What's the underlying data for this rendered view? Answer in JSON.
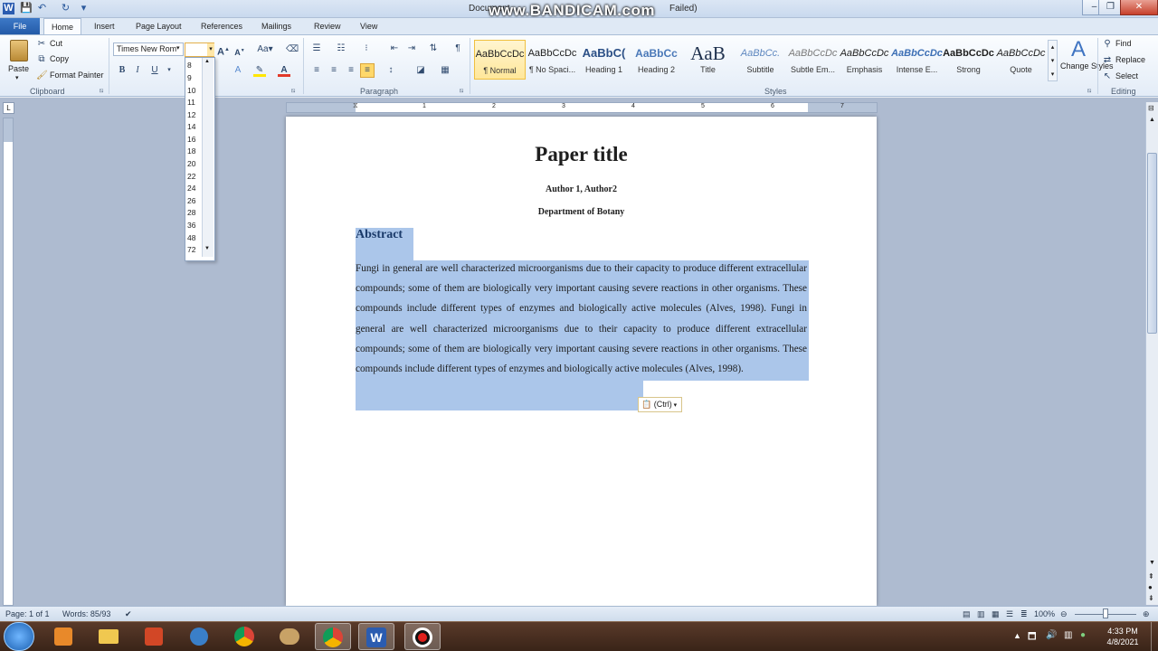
{
  "window": {
    "title": "Document",
    "title_tail": "Failed)",
    "watermark": "www.BANDICAM.com",
    "controls": [
      "–",
      "❐",
      "✕"
    ]
  },
  "tabs": {
    "file": "File",
    "items": [
      "Home",
      "Insert",
      "Page Layout",
      "References",
      "Mailings",
      "Review",
      "View"
    ]
  },
  "clipboard": {
    "paste": "Paste",
    "cut": "Cut",
    "copy": "Copy",
    "format_painter": "Format Painter",
    "label": "Clipboard"
  },
  "font": {
    "family": "Times New Rom",
    "size": "",
    "bold": "B",
    "italic": "I",
    "underline": "U",
    "change_case": "Aa",
    "sizes": [
      "8",
      "9",
      "10",
      "11",
      "12",
      "14",
      "16",
      "18",
      "20",
      "22",
      "24",
      "26",
      "28",
      "36",
      "48",
      "72"
    ]
  },
  "paragraph": {
    "label": "Paragraph",
    "pilcrow": "¶"
  },
  "styles": {
    "label": "Styles",
    "items": [
      {
        "sample": "AaBbCcDc",
        "name": "¶ Normal"
      },
      {
        "sample": "AaBbCcDc",
        "name": "¶ No Spaci..."
      },
      {
        "sample": "AaBbC(",
        "name": "Heading 1"
      },
      {
        "sample": "AaBbCc",
        "name": "Heading 2"
      },
      {
        "sample": "AaB",
        "name": "Title"
      },
      {
        "sample": "AaBbCc.",
        "name": "Subtitle"
      },
      {
        "sample": "AaBbCcDc",
        "name": "Subtle Em..."
      },
      {
        "sample": "AaBbCcDc",
        "name": "Emphasis"
      },
      {
        "sample": "AaBbCcDc",
        "name": "Intense E..."
      },
      {
        "sample": "AaBbCcDc",
        "name": "Strong"
      },
      {
        "sample": "AaBbCcDc",
        "name": "Quote"
      }
    ],
    "change_styles": "Change Styles",
    "change_styles_line2": "Styles"
  },
  "editing": {
    "find": "Find",
    "replace": "Replace",
    "select": "Select",
    "label": "Editing"
  },
  "document": {
    "title": "Paper title",
    "authors": "Author  1, Author2",
    "department": "Department of Botany",
    "abstract_heading": "Abstract",
    "abstract_body": "Fungi in general are well characterized microorganisms due to their capacity to produce different extracellular compounds; some of them are biologically very important causing severe reactions in other organisms. These compounds include different types of enzymes and biologically active molecules (Alves, 1998). Fungi in general are well characterized microorganisms due to their capacity to produce different extracellular compounds; some of them are biologically very important causing severe reactions in other organisms. These compounds include different types of enzymes and biologically active molecules (Alves, 1998).",
    "paste_options": "(Ctrl)"
  },
  "status": {
    "page": "Page: 1 of 1",
    "words": "Words: 85/93",
    "zoom": "100%"
  },
  "taskbar": {
    "time": "4:33 PM",
    "date": "4/8/2021"
  },
  "colors": {
    "selection": "#abc6ea",
    "file_tab": "#2b62ae",
    "style_selected": "#ffe79a"
  }
}
